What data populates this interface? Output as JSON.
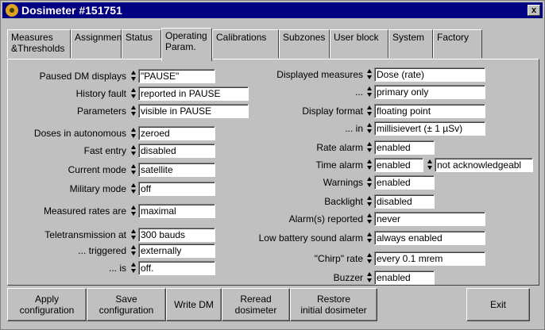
{
  "window": {
    "title": "Dosimeter #151751",
    "close_label": "x"
  },
  "tabs": [
    {
      "label": "Measures &Thresholds"
    },
    {
      "label": "Assignment"
    },
    {
      "label": "Status"
    },
    {
      "label": "Operating Param."
    },
    {
      "label": "Calibrations"
    },
    {
      "label": "Subzones"
    },
    {
      "label": "User block"
    },
    {
      "label": "System"
    },
    {
      "label": "Factory"
    }
  ],
  "left": [
    {
      "label": "Paused DM displays",
      "value": "\"PAUSE\""
    },
    {
      "label": "History fault",
      "value": "reported in PAUSE"
    },
    {
      "label": "Parameters",
      "value": "visible in PAUSE"
    },
    {
      "label": "Doses in autonomous",
      "value": "zeroed"
    },
    {
      "label": "Fast entry",
      "value": "disabled"
    },
    {
      "label": "Current mode",
      "value": "satellite"
    },
    {
      "label": "Military mode",
      "value": "off"
    },
    {
      "label": "Measured rates are",
      "value": "maximal"
    },
    {
      "label": "Teletransmission at",
      "value": "300 bauds"
    },
    {
      "label": "... triggered",
      "value": "externally"
    },
    {
      "label": "... is",
      "value": "off."
    }
  ],
  "right": [
    {
      "label": "Displayed measures",
      "value": "Dose (rate)"
    },
    {
      "label": "...",
      "value": "primary only"
    },
    {
      "label": "Display format",
      "value": "floating point"
    },
    {
      "label": "... in",
      "value": "millisievert (± 1 µSv)"
    },
    {
      "label": "Rate alarm",
      "value": "enabled"
    },
    {
      "label": "Time alarm",
      "value": "enabled",
      "value2": "not acknowledgeabl"
    },
    {
      "label": "Warnings",
      "value": "enabled"
    },
    {
      "label": "Backlight",
      "value": "disabled"
    },
    {
      "label": "Alarm(s) reported",
      "value": "never"
    },
    {
      "label": "Low battery sound alarm",
      "value": "always enabled"
    },
    {
      "label": "\"Chirp\" rate",
      "value": "every 0.1 mrem"
    },
    {
      "label": "Buzzer",
      "value": "enabled"
    }
  ],
  "buttons": {
    "apply": [
      "Apply",
      "configuration"
    ],
    "save": [
      "Save",
      "configuration"
    ],
    "write": [
      "Write DM"
    ],
    "reread": [
      "Reread",
      "dosimeter"
    ],
    "restore": [
      "Restore",
      "initial dosimeter"
    ],
    "exit": [
      "Exit"
    ]
  }
}
